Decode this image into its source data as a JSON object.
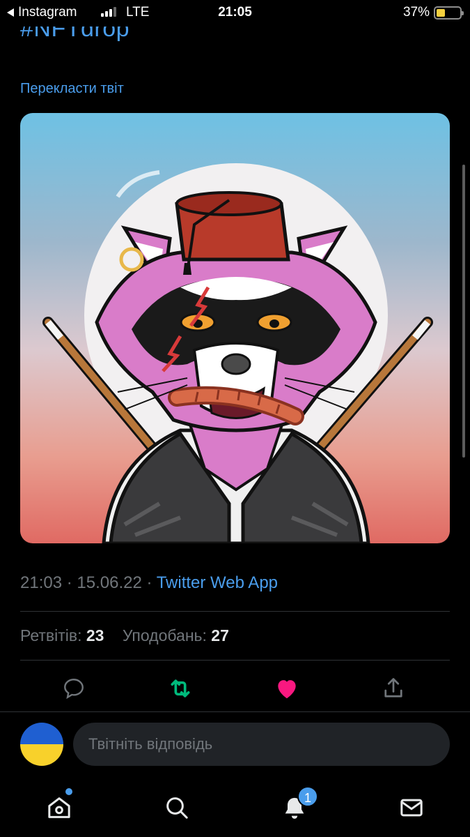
{
  "status_bar": {
    "back_app": "Instagram",
    "network": "LTE",
    "time": "21:05",
    "battery_percent": "37%",
    "battery_level": 0.37
  },
  "tweet": {
    "hashtag": "#NFTdrop",
    "translate_label": "Перекласти твіт",
    "image_icon": "raccoon-nft-illustration",
    "timestamp": "21:03 · 15.06.22 · ",
    "source": "Twitter Web App",
    "retweets_label": "Ретвітів:",
    "retweets_count": "23",
    "likes_label": "Уподобань:",
    "likes_count": "27"
  },
  "actions": {
    "reply_icon": "reply-icon",
    "retweet_icon": "retweet-icon",
    "like_icon": "heart-icon",
    "share_icon": "share-icon",
    "retweet_color": "#00ba7c",
    "like_color": "#f91880"
  },
  "reply": {
    "placeholder": "Твітніть відповідь",
    "avatar": "ukraine-flag-avatar"
  },
  "tab_bar": {
    "home_icon": "home-icon",
    "search_icon": "search-icon",
    "notifications_icon": "bell-icon",
    "notifications_badge": "1",
    "messages_icon": "mail-icon"
  },
  "colors": {
    "accent": "#4a9dec",
    "background": "#000000",
    "muted_text": "#71767b"
  }
}
